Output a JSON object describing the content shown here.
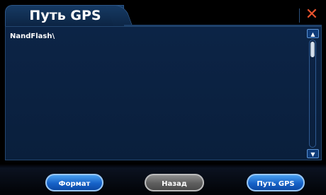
{
  "window": {
    "title": "Путь GPS",
    "close_glyph": "✕"
  },
  "content": {
    "current_path": "NandFlash\\"
  },
  "scrollbar": {
    "up_glyph": "▲",
    "down_glyph": "▼"
  },
  "buttons": {
    "format": "Формат",
    "back": "Назад",
    "gps_path": "Путь GPS"
  },
  "colors": {
    "panel_bg": "#0b2140",
    "close_accent": "#e8532e",
    "button_blue": "#1662c8",
    "button_gray": "#5e5e5e"
  }
}
